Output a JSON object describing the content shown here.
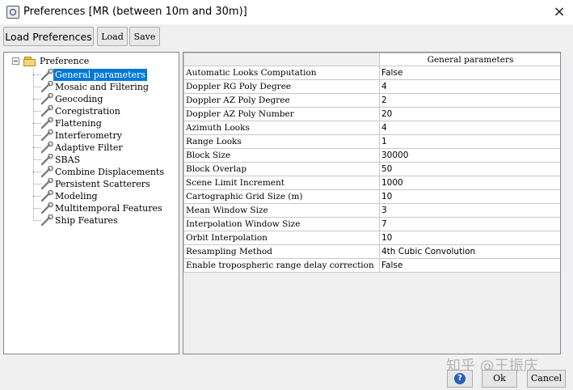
{
  "window": {
    "title": "Preferences [MR (between 10m and 30m)]",
    "close_glyph": "×"
  },
  "toolbar": {
    "load_preferences": "Load Preferences",
    "load": "Load",
    "save": "Save"
  },
  "tree": {
    "root": "Preference",
    "items": [
      {
        "label": "General parameters",
        "selected": true
      },
      {
        "label": "Mosaic and Filtering"
      },
      {
        "label": "Geocoding"
      },
      {
        "label": "Coregistration"
      },
      {
        "label": "Flattening"
      },
      {
        "label": "Interferometry"
      },
      {
        "label": "Adaptive Filter"
      },
      {
        "label": "SBAS"
      },
      {
        "label": "Combine Displacements"
      },
      {
        "label": "Persistent Scatterers"
      },
      {
        "label": "Modeling"
      },
      {
        "label": "Multitemporal Features"
      },
      {
        "label": "Ship Features"
      }
    ]
  },
  "table": {
    "header": "General parameters",
    "rows": [
      {
        "name": "Automatic Looks Computation",
        "value": "False"
      },
      {
        "name": "Doppler RG Poly Degree",
        "value": "4"
      },
      {
        "name": "Doppler AZ Poly Degree",
        "value": "2"
      },
      {
        "name": "Doppler AZ Poly Number",
        "value": "20"
      },
      {
        "name": "Azimuth Looks",
        "value": "4"
      },
      {
        "name": "Range Looks",
        "value": "1"
      },
      {
        "name": "Block Size",
        "value": "30000"
      },
      {
        "name": "Block Overlap",
        "value": "50"
      },
      {
        "name": "Scene Limit Increment",
        "value": "1000"
      },
      {
        "name": "Cartographic Grid Size (m)",
        "value": "10"
      },
      {
        "name": "Mean Window Size",
        "value": "3"
      },
      {
        "name": "Interpolation Window Size",
        "value": "7"
      },
      {
        "name": "Orbit Interpolation",
        "value": "10"
      },
      {
        "name": "Resampling Method",
        "value": "4th Cubic Convolution"
      },
      {
        "name": "Enable tropospheric range delay correction",
        "value": "False"
      }
    ]
  },
  "footer": {
    "watermark": "知乎 @王振庆",
    "help": "?",
    "ok": "Ok",
    "cancel": "Cancel"
  },
  "colors": {
    "selection": "#0078d7",
    "folder": "#f5d57a"
  },
  "icons": {
    "app": "app-icon",
    "close": "close-icon",
    "folder": "folder-icon",
    "wrench": "wrench-icon",
    "help": "help-icon"
  }
}
